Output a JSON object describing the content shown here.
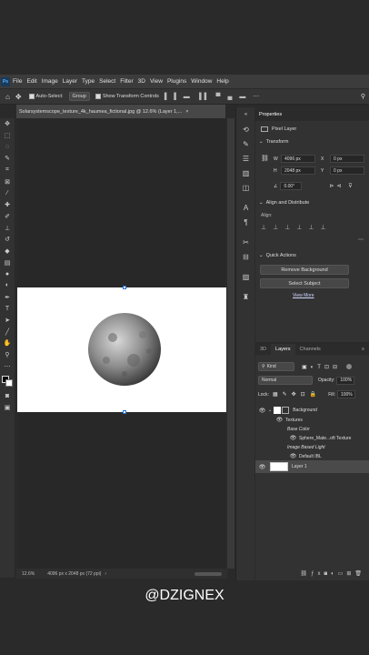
{
  "app": {
    "logo": "Ps"
  },
  "menu": [
    "File",
    "Edit",
    "Image",
    "Layer",
    "Type",
    "Select",
    "Filter",
    "3D",
    "View",
    "Plugins",
    "Window",
    "Help"
  ],
  "options": {
    "auto_select_label": "Auto-Select:",
    "auto_select_value": "Group",
    "show_transform_label": "Show Transform Controls"
  },
  "document": {
    "tab_title": "Solarsystemscope_texture_4k_haumea_fictional.jpg @ 12.6% (Layer 1,...",
    "zoom": "12.6%",
    "size": "4096 px x 2048 px (72 ppi)"
  },
  "properties": {
    "tab": "Properties",
    "layer_type": "Pixel Layer",
    "transform_label": "Transform",
    "w_label": "W",
    "w_value": "4096 px",
    "h_label": "H",
    "h_value": "2048 px",
    "x_label": "X",
    "x_value": "0 px",
    "y_label": "Y",
    "y_value": "0 px",
    "angle_value": "0.00°",
    "align_section": "Align and Distribute",
    "align_label": "Align:",
    "quick_actions": "Quick Actions",
    "remove_bg": "Remove Background",
    "select_subject": "Select Subject",
    "view_more": "View More"
  },
  "layers": {
    "tabs": [
      "3D",
      "Layers",
      "Channels"
    ],
    "filter_kind": "Kind",
    "blend_mode": "Normal",
    "opacity_label": "Opacity:",
    "opacity_value": "100%",
    "lock_label": "Lock:",
    "fill_label": "Fill:",
    "fill_value": "100%",
    "items": [
      {
        "name": "Background"
      },
      {
        "name": "Textures"
      },
      {
        "name": "Base Color"
      },
      {
        "name": "Sphere_Mate...oft Texture"
      },
      {
        "name": "Image Based Light"
      },
      {
        "name": "Default IBL"
      },
      {
        "name": "Layer 1"
      }
    ]
  },
  "watermark": "@DZIGNEX",
  "colors": {
    "accent": "#246fd0",
    "panel": "#323232",
    "canvas_bg": "#282828"
  }
}
